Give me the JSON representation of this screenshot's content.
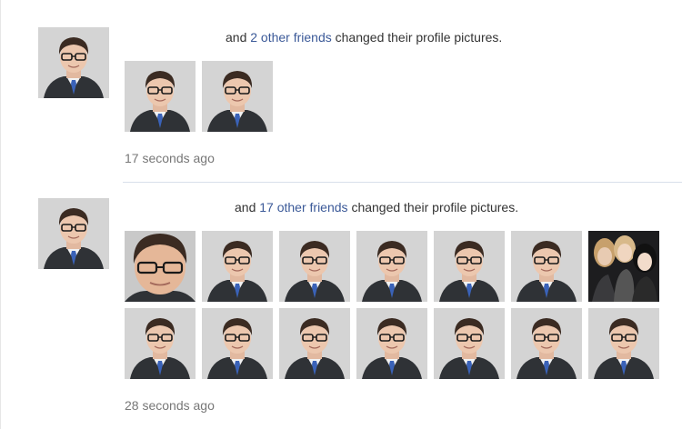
{
  "story1": {
    "headline_prefix": "and",
    "friends_link": "2 other friends",
    "headline_suffix": "changed their profile pictures.",
    "timestamp": "17 seconds ago",
    "thumbnails": [
      "man",
      "man"
    ]
  },
  "story2": {
    "headline_prefix": "and",
    "friends_link": "17 other friends",
    "headline_suffix": "changed their profile pictures.",
    "timestamp": "28 seconds ago",
    "thumbnails": [
      "man-closeup",
      "man",
      "man",
      "man",
      "man",
      "man",
      "group",
      "man",
      "man",
      "man",
      "man",
      "man",
      "man",
      "man"
    ]
  },
  "colors": {
    "link": "#3b5998",
    "timestamp": "#777777",
    "divider": "#d8dfea"
  },
  "icons": {
    "profile": "man-in-suit-with-glasses-photo",
    "group": "group-of-girls-photo"
  }
}
